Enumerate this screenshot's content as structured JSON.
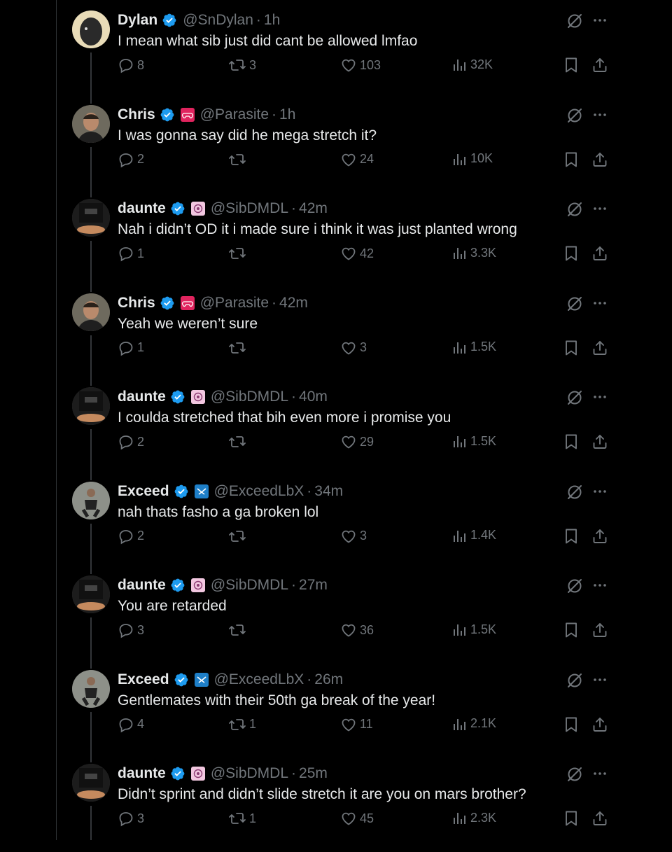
{
  "colors": {
    "background": "#000000",
    "text": "#e7e9ea",
    "muted": "#71767b",
    "verified": "#1d9bf0"
  },
  "tweets": [
    {
      "name": "Dylan",
      "handle": "@SnDylan",
      "time": "1h",
      "affiliate": null,
      "text": "I mean what sib just did cant be allowed lmfao",
      "replies": "8",
      "reposts": "3",
      "likes": "103",
      "views": "32K"
    },
    {
      "name": "Chris",
      "handle": "@Parasite",
      "time": "1h",
      "affiliate": "gamepad-badge-icon",
      "text": "I was gonna say did he mega stretch it?",
      "replies": "2",
      "reposts": "",
      "likes": "24",
      "views": "10K"
    },
    {
      "name": "daunte",
      "handle": "@SibDMDL",
      "time": "42m",
      "affiliate": "dmdl-badge-icon",
      "text": "Nah i didn’t OD it i made sure i think it was just planted wrong",
      "replies": "1",
      "reposts": "",
      "likes": "42",
      "views": "3.3K"
    },
    {
      "name": "Chris",
      "handle": "@Parasite",
      "time": "42m",
      "affiliate": "gamepad-badge-icon",
      "text": "Yeah we weren’t sure",
      "replies": "1",
      "reposts": "",
      "likes": "3",
      "views": "1.5K"
    },
    {
      "name": "daunte",
      "handle": "@SibDMDL",
      "time": "40m",
      "affiliate": "dmdl-badge-icon",
      "text": "I coulda stretched that bih even more i promise you",
      "replies": "2",
      "reposts": "",
      "likes": "29",
      "views": "1.5K"
    },
    {
      "name": "Exceed",
      "handle": "@ExceedLbX",
      "time": "34m",
      "affiliate": "exceed-badge-icon",
      "text": "nah thats fasho a ga broken lol",
      "replies": "2",
      "reposts": "",
      "likes": "3",
      "views": "1.4K"
    },
    {
      "name": "daunte",
      "handle": "@SibDMDL",
      "time": "27m",
      "affiliate": "dmdl-badge-icon",
      "text": "You are retarded",
      "replies": "3",
      "reposts": "",
      "likes": "36",
      "views": "1.5K"
    },
    {
      "name": "Exceed",
      "handle": "@ExceedLbX",
      "time": "26m",
      "affiliate": "exceed-badge-icon",
      "text": "Gentlemates with their 50th ga break of the year!",
      "replies": "4",
      "reposts": "1",
      "likes": "11",
      "views": "2.1K"
    },
    {
      "name": "daunte",
      "handle": "@SibDMDL",
      "time": "25m",
      "affiliate": "dmdl-badge-icon",
      "text": "Didn’t sprint and didn’t slide stretch it are you on mars brother?",
      "replies": "3",
      "reposts": "1",
      "likes": "45",
      "views": "2.3K"
    }
  ]
}
